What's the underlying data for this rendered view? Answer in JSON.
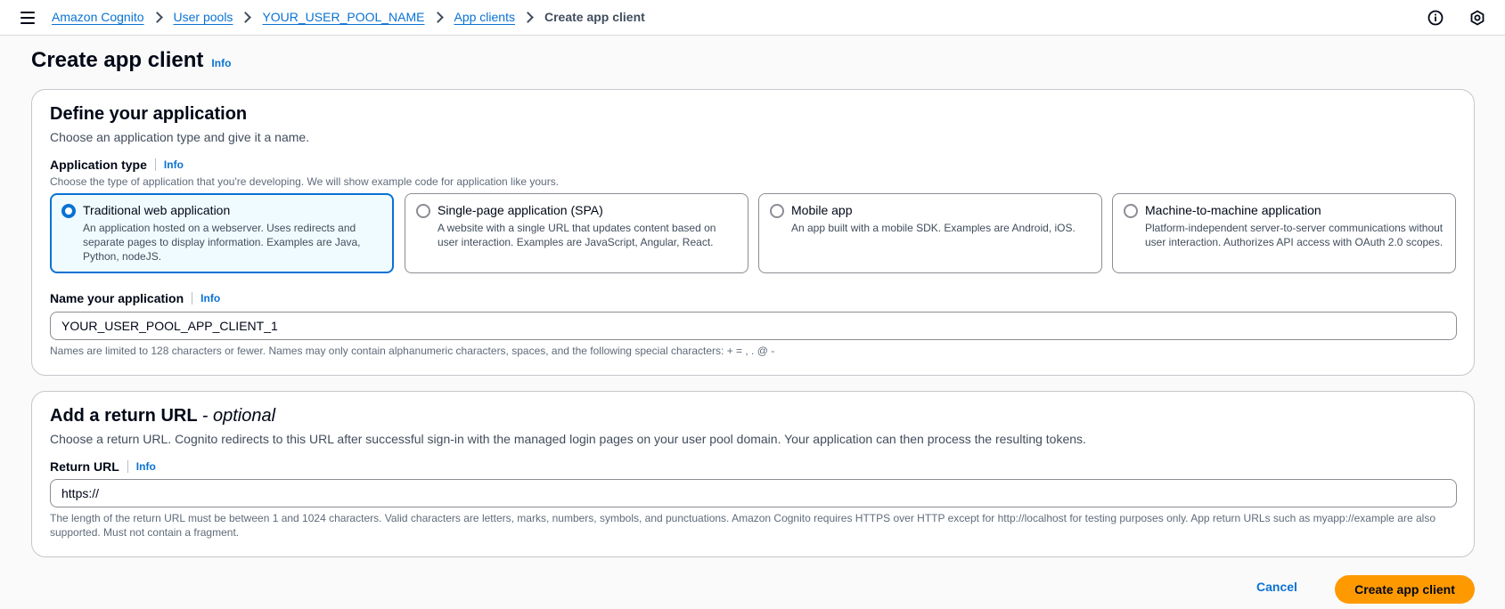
{
  "breadcrumbs": [
    {
      "label": "Amazon Cognito"
    },
    {
      "label": "User pools"
    },
    {
      "label": "YOUR_USER_POOL_NAME"
    },
    {
      "label": "App clients"
    },
    {
      "label": "Create app client"
    }
  ],
  "header": {
    "menu_icon": "hamburger-menu-icon",
    "right_icons": [
      "info-circle-icon",
      "settings-hex-icon"
    ]
  },
  "page": {
    "title": "Create app client",
    "info": "Info"
  },
  "define": {
    "title": "Define your application",
    "description": "Choose an application type and give it a name.",
    "app_type_label": "Application type",
    "app_type_info": "Info",
    "app_type_hint": "Choose the type of application that you're developing. We will show example code for application like yours.",
    "tiles": [
      {
        "title": "Traditional web application",
        "description": "An application hosted on a webserver. Uses redirects and separate pages to display information. Examples are Java, Python, nodeJS.",
        "selected": true
      },
      {
        "title": "Single-page application (SPA)",
        "description": "A website with a single URL that updates content based on user interaction. Examples are JavaScript, Angular, React.",
        "selected": false
      },
      {
        "title": "Mobile app",
        "description": "An app built with a mobile SDK. Examples are Android, iOS.",
        "selected": false
      },
      {
        "title": "Machine-to-machine application",
        "description": "Platform-independent server-to-server communications without user interaction. Authorizes API access with OAuth 2.0 scopes.",
        "selected": false
      }
    ],
    "name_label": "Name your application",
    "name_info": "Info",
    "name_value": "YOUR_USER_POOL_APP_CLIENT_1",
    "name_hint": "Names are limited to 128 characters or fewer. Names may only contain alphanumeric characters, spaces, and the following special characters: + = , . @ -"
  },
  "return_url": {
    "title": "Add a return URL",
    "title_suffix": "- optional",
    "description": "Choose a return URL. Cognito redirects to this URL after successful sign-in with the managed login pages on your user pool domain. Your application can then process the resulting tokens.",
    "label": "Return URL",
    "info": "Info",
    "value": "https://",
    "hint": "The length of the return URL must be between 1 and 1024 characters. Valid characters are letters, marks, numbers, symbols, and punctuations. Amazon Cognito requires HTTPS over HTTP except for http://localhost for testing purposes only. App return URLs such as myapp://example are also supported. Must not contain a fragment."
  },
  "actions": {
    "cancel": "Cancel",
    "submit": "Create app client"
  },
  "colors": {
    "link": "#0972d3",
    "primary_button": "#ff9900",
    "selected_tile_bg": "#f0fbff"
  }
}
